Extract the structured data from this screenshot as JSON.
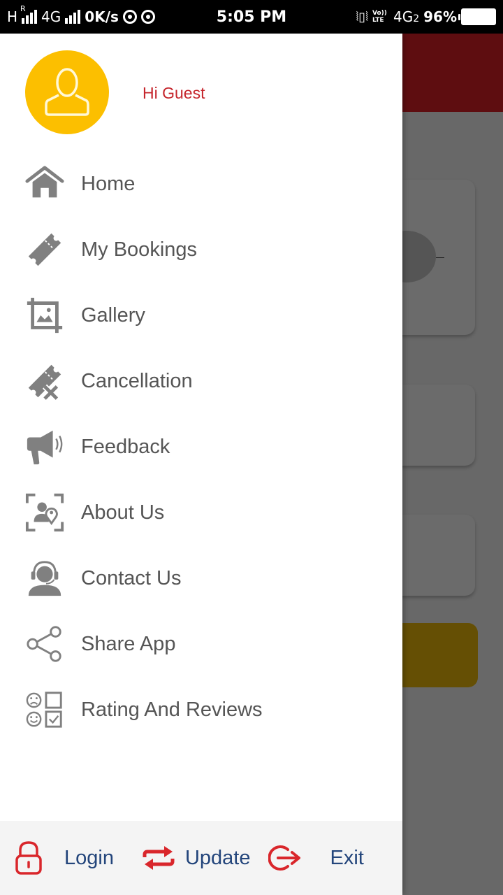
{
  "status_bar": {
    "network_left": "H",
    "roaming": "R",
    "network_type": "4G",
    "data_speed": "0K/s",
    "time": "5:05 PM",
    "volte": "Vo)) LTE",
    "network_right": "4G",
    "sim_slot": "2",
    "battery": "96%"
  },
  "drawer": {
    "greeting": "Hi Guest",
    "avatar_icon": "user-icon",
    "icon_color": "#808080",
    "menu": [
      {
        "id": "home",
        "label": "Home",
        "icon": "home-icon"
      },
      {
        "id": "my-bookings",
        "label": "My Bookings",
        "icon": "ticket-icon"
      },
      {
        "id": "gallery",
        "label": "Gallery",
        "icon": "gallery-icon"
      },
      {
        "id": "cancellation",
        "label": "Cancellation",
        "icon": "ticket-cancel-icon"
      },
      {
        "id": "feedback",
        "label": "Feedback",
        "icon": "megaphone-icon"
      },
      {
        "id": "about-us",
        "label": "About Us",
        "icon": "about-icon"
      },
      {
        "id": "contact-us",
        "label": "Contact Us",
        "icon": "headset-icon"
      },
      {
        "id": "share-app",
        "label": "Share App",
        "icon": "share-icon"
      },
      {
        "id": "rating-reviews",
        "label": "Rating And Reviews",
        "icon": "rating-icon"
      }
    ],
    "bottom": [
      {
        "id": "login",
        "label": "Login",
        "icon": "lock-icon"
      },
      {
        "id": "update",
        "label": "Update",
        "icon": "swap-arrows-icon"
      },
      {
        "id": "exit",
        "label": "Exit",
        "icon": "exit-icon"
      }
    ]
  },
  "colors": {
    "accent_red": "#d9262b",
    "greeting_red": "#c5252c",
    "avatar_yellow": "#fcbf00",
    "bottom_label_blue": "#23457b",
    "menu_text": "#555555"
  }
}
